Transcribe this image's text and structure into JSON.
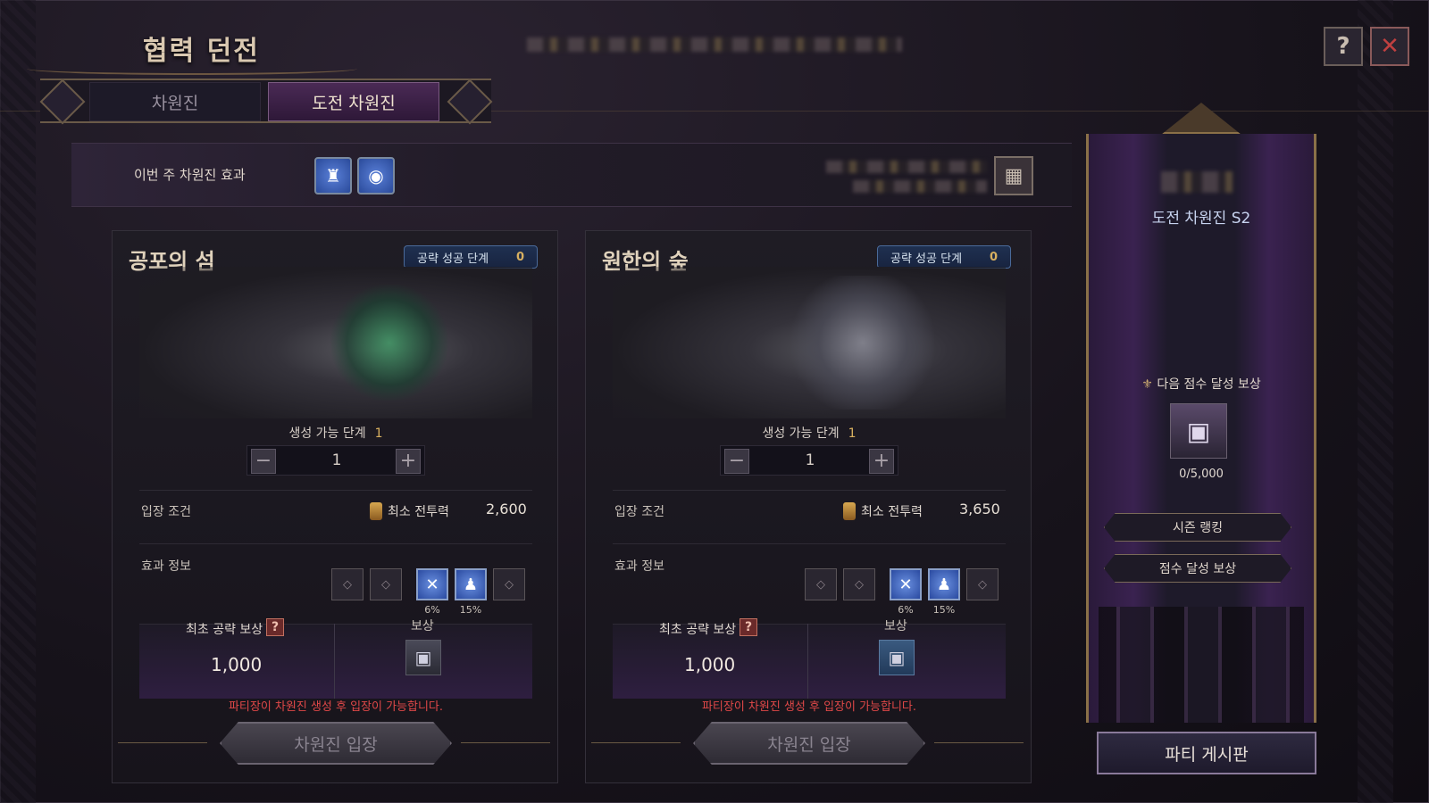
{
  "header": {
    "title": "협력 던전",
    "tabs": [
      {
        "label": "차원진",
        "active": false
      },
      {
        "label": "도전 차원진",
        "active": true
      }
    ],
    "help_icon": "book-question-icon",
    "close_icon": "close-x-icon"
  },
  "effects_bar": {
    "label": "이번 주 차원진 효과",
    "icons": [
      "totem-effect-icon",
      "shield-wave-effect-icon"
    ],
    "calendar_icon": "calendar-icon"
  },
  "dungeons": [
    {
      "name": "공포의 섬",
      "stage_label": "공략 성공 단계",
      "stage_value": "0",
      "gen_label": "생성 가능 단계",
      "gen_value": "1",
      "stepper_value": "1",
      "entry_label": "입장 조건",
      "power_label": "최소 전투력",
      "power_value": "2,600",
      "effect_label": "효과 정보",
      "buff_pcts": [
        "6%",
        "15%"
      ],
      "first_reward_label": "최초 공략 보상",
      "first_reward_value": "1,000",
      "reward_label": "보상",
      "warning": "파티장이 차원진 생성 후 입장이 가능합니다.",
      "enter_label": "차원진 입장"
    },
    {
      "name": "원한의 숲",
      "stage_label": "공략 성공 단계",
      "stage_value": "0",
      "gen_label": "생성 가능 단계",
      "gen_value": "1",
      "stepper_value": "1",
      "entry_label": "입장 조건",
      "power_label": "최소 전투력",
      "power_value": "3,650",
      "effect_label": "효과 정보",
      "buff_pcts": [
        "6%",
        "15%"
      ],
      "first_reward_label": "최초 공략 보상",
      "first_reward_value": "1,000",
      "reward_label": "보상",
      "warning": "파티장이 차원진 생성 후 입장이 가능합니다.",
      "enter_label": "차원진 입장"
    }
  ],
  "season_panel": {
    "title": "도전 차원진 S2",
    "next_reward_label": "다음 점수 달성 보상",
    "progress": "0/5,000",
    "ranking_button": "시즌 랭킹",
    "score_reward_button": "점수 달성 보상",
    "party_board_button": "파티 게시판"
  },
  "colors": {
    "accent_gold": "#d8b060",
    "warning_red": "#e04848",
    "active_tab": "#4a2a55"
  }
}
